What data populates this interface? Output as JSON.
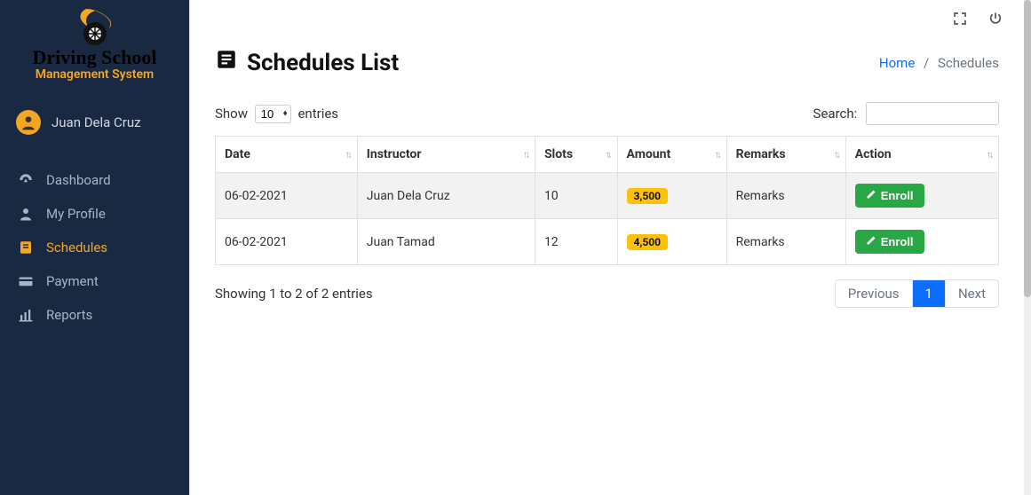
{
  "brand": {
    "title": "Driving School",
    "subtitle": "Management System"
  },
  "user": {
    "name": "Juan Dela Cruz"
  },
  "nav": {
    "items": [
      {
        "label": "Dashboard",
        "icon": "gauge-icon",
        "active": false
      },
      {
        "label": "My Profile",
        "icon": "user-icon",
        "active": false
      },
      {
        "label": "Schedules",
        "icon": "book-icon",
        "active": true
      },
      {
        "label": "Payment",
        "icon": "card-icon",
        "active": false
      },
      {
        "label": "Reports",
        "icon": "chart-icon",
        "active": false
      }
    ]
  },
  "page": {
    "title": "Schedules List"
  },
  "breadcrumb": {
    "home": "Home",
    "current": "Schedules"
  },
  "datatable": {
    "show_prefix": "Show",
    "length_value": "10",
    "show_suffix": "entries",
    "search_label": "Search:",
    "search_value": "",
    "columns": [
      "Date",
      "Instructor",
      "Slots",
      "Amount",
      "Remarks",
      "Action"
    ],
    "rows": [
      {
        "date": "06-02-2021",
        "instructor": "Juan Dela Cruz",
        "slots": "10",
        "amount": "3,500",
        "remarks": "Remarks"
      },
      {
        "date": "06-02-2021",
        "instructor": "Juan Tamad",
        "slots": "12",
        "amount": "4,500",
        "remarks": "Remarks"
      }
    ],
    "enroll_label": "Enroll",
    "info": "Showing 1 to 2 of 2 entries",
    "pagination": {
      "previous": "Previous",
      "next": "Next",
      "pages": [
        "1"
      ],
      "active": "1"
    }
  }
}
